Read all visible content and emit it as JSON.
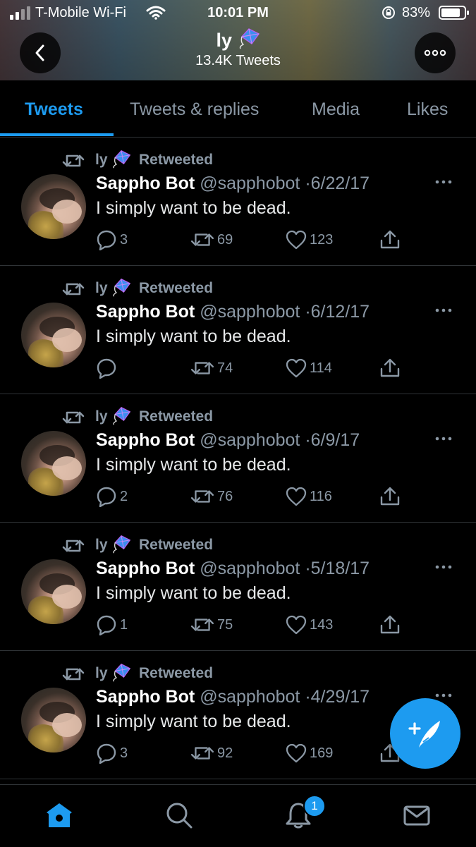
{
  "status_bar": {
    "carrier": "T-Mobile Wi-Fi",
    "time": "10:01 PM",
    "battery": "83%",
    "battery_level": 0.83
  },
  "header": {
    "name": "ly",
    "name_emoji_icon": "kite-icon",
    "tweet_count": "13.4K Tweets"
  },
  "tabs": [
    {
      "label": "Tweets",
      "active": true
    },
    {
      "label": "Tweets & replies",
      "active": false
    },
    {
      "label": "Media",
      "active": false
    },
    {
      "label": "Likes",
      "active": false
    }
  ],
  "tweets": [
    {
      "retweeter": "ly",
      "retweeted_label": "Retweeted",
      "author": "Sappho Bot",
      "handle": "@sapphobot",
      "separator": "·",
      "date": "6/22/17",
      "text": "I simply want to be dead.",
      "replies": "3",
      "retweets": "69",
      "likes": "123"
    },
    {
      "retweeter": "ly",
      "retweeted_label": "Retweeted",
      "author": "Sappho Bot",
      "handle": "@sapphobot",
      "separator": "·",
      "date": "6/12/17",
      "text": "I simply want to be dead.",
      "replies": "",
      "retweets": "74",
      "likes": "114"
    },
    {
      "retweeter": "ly",
      "retweeted_label": "Retweeted",
      "author": "Sappho Bot",
      "handle": "@sapphobot",
      "separator": "·",
      "date": "6/9/17",
      "text": "I simply want to be dead.",
      "replies": "2",
      "retweets": "76",
      "likes": "116"
    },
    {
      "retweeter": "ly",
      "retweeted_label": "Retweeted",
      "author": "Sappho Bot",
      "handle": "@sapphobot",
      "separator": "·",
      "date": "5/18/17",
      "text": "I simply want to be dead.",
      "replies": "1",
      "retweets": "75",
      "likes": "143"
    },
    {
      "retweeter": "ly",
      "retweeted_label": "Retweeted",
      "author": "Sappho Bot",
      "handle": "@sapphobot",
      "separator": "·",
      "date": "4/29/17",
      "text": "I simply want to be dead.",
      "replies": "3",
      "retweets": "92",
      "likes": "169"
    }
  ],
  "bottom_nav": {
    "items": [
      "home-icon",
      "search-icon",
      "bell-icon",
      "mail-icon"
    ],
    "notification_badge": "1"
  },
  "colors": {
    "accent": "#1d9bf0",
    "muted": "#8b98a5",
    "background": "#000000"
  }
}
